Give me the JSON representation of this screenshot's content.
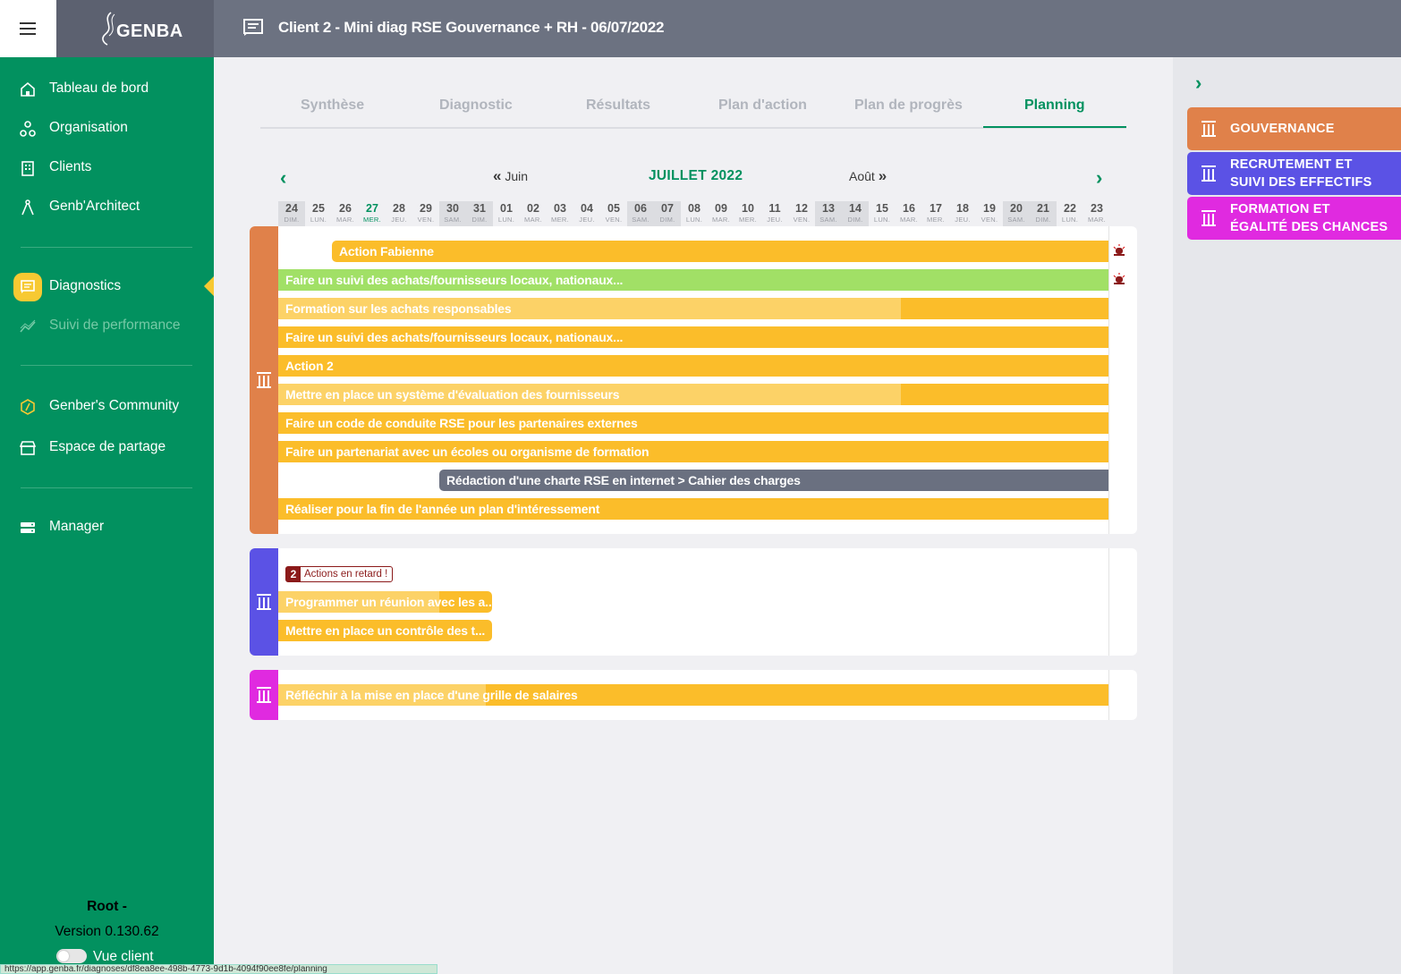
{
  "app": {
    "logo": "GENBA",
    "title": "Client 2 - Mini diag RSE Gouvernance + RH - 06/07/2022"
  },
  "sidebar": {
    "items": [
      {
        "label": "Tableau de bord",
        "icon": "home-icon"
      },
      {
        "label": "Organisation",
        "icon": "org-icon"
      },
      {
        "label": "Clients",
        "icon": "building-icon"
      },
      {
        "label": "Genb'Architect",
        "icon": "compass-icon"
      },
      {
        "label": "Diagnostics",
        "icon": "doc-icon"
      },
      {
        "label": "Suivi de performance",
        "icon": "chart-icon"
      },
      {
        "label": "Genber's Community",
        "icon": "community-icon"
      },
      {
        "label": "Espace de partage",
        "icon": "store-icon"
      },
      {
        "label": "Manager",
        "icon": "server-icon"
      }
    ],
    "footer": {
      "user": "Root -",
      "version": "Version 0.130.62",
      "toggle_label": "Vue client"
    },
    "status_url": "https://app.genba.fr/diagnoses/df8ea8ee-498b-4773-9d1b-4094f90ee8fe/planning"
  },
  "tabs": [
    "Synthèse",
    "Diagnostic",
    "Résultats",
    "Plan d'action",
    "Plan de progrès",
    "Planning"
  ],
  "active_tab": "Planning",
  "calendar": {
    "prev_month": "Juin",
    "current_month": "JUILLET 2022",
    "next_month": "Août",
    "today": "27",
    "days": [
      {
        "n": "24",
        "w": "DIM."
      },
      {
        "n": "25",
        "w": "LUN."
      },
      {
        "n": "26",
        "w": "MAR."
      },
      {
        "n": "27",
        "w": "MER."
      },
      {
        "n": "28",
        "w": "JEU."
      },
      {
        "n": "29",
        "w": "VEN."
      },
      {
        "n": "30",
        "w": "SAM."
      },
      {
        "n": "31",
        "w": "DIM."
      },
      {
        "n": "01",
        "w": "LUN."
      },
      {
        "n": "02",
        "w": "MAR."
      },
      {
        "n": "03",
        "w": "MER."
      },
      {
        "n": "04",
        "w": "JEU."
      },
      {
        "n": "05",
        "w": "VEN."
      },
      {
        "n": "06",
        "w": "SAM."
      },
      {
        "n": "07",
        "w": "DIM."
      },
      {
        "n": "08",
        "w": "LUN."
      },
      {
        "n": "09",
        "w": "MAR."
      },
      {
        "n": "10",
        "w": "MER."
      },
      {
        "n": "11",
        "w": "JEU."
      },
      {
        "n": "12",
        "w": "VEN."
      },
      {
        "n": "13",
        "w": "SAM."
      },
      {
        "n": "14",
        "w": "DIM."
      },
      {
        "n": "15",
        "w": "LUN."
      },
      {
        "n": "16",
        "w": "MAR."
      },
      {
        "n": "17",
        "w": "MER."
      },
      {
        "n": "18",
        "w": "JEU."
      },
      {
        "n": "19",
        "w": "VEN."
      },
      {
        "n": "20",
        "w": "SAM."
      },
      {
        "n": "21",
        "w": "DIM."
      },
      {
        "n": "22",
        "w": "LUN."
      },
      {
        "n": "23",
        "w": "MAR."
      }
    ]
  },
  "groups": [
    {
      "pillar": "Gouvernance",
      "color": "#e0814a",
      "actions": [
        {
          "label": "Action Fabienne",
          "alarm": true
        },
        {
          "label": "Faire un suivi des achats/fournisseurs locaux, nationaux...",
          "alarm": true
        },
        {
          "label": "Formation sur les achats responsables"
        },
        {
          "label": "Faire un suivi des achats/fournisseurs locaux, nationaux..."
        },
        {
          "label": "Action 2"
        },
        {
          "label": "Mettre en place un système d'évaluation des fournisseurs"
        },
        {
          "label": "Faire un code de conduite RSE pour les partenaires externes"
        },
        {
          "label": "Faire un partenariat avec un écoles ou organisme de formation"
        },
        {
          "label": "Rédaction d'une charte RSE en internet > Cahier des charges"
        },
        {
          "label": "Réaliser pour la fin de l'année un plan d'intéressement"
        }
      ]
    },
    {
      "pillar": "Recrutement et suivi des effectifs",
      "color": "#5b52e5",
      "late_count": "2",
      "late_label": "Actions en retard !",
      "actions": [
        {
          "label": "Programmer un réunion avec les a..."
        },
        {
          "label": "Mettre en place un contrôle des t..."
        }
      ]
    },
    {
      "pillar": "Formation et égalité des chances",
      "color": "#e02ae0",
      "actions": [
        {
          "label": "Réfléchir à la mise en place d'une grille de salaires"
        }
      ]
    }
  ],
  "pillars": [
    {
      "line1": "Gouvernance",
      "line2": "",
      "color": "#e0814a"
    },
    {
      "line1": "Recrutement et",
      "line2": "suivi des effectifs",
      "color": "#5b52e5"
    },
    {
      "line1": "Formation et",
      "line2": "égalité des chances",
      "color": "#e02ae0"
    }
  ]
}
